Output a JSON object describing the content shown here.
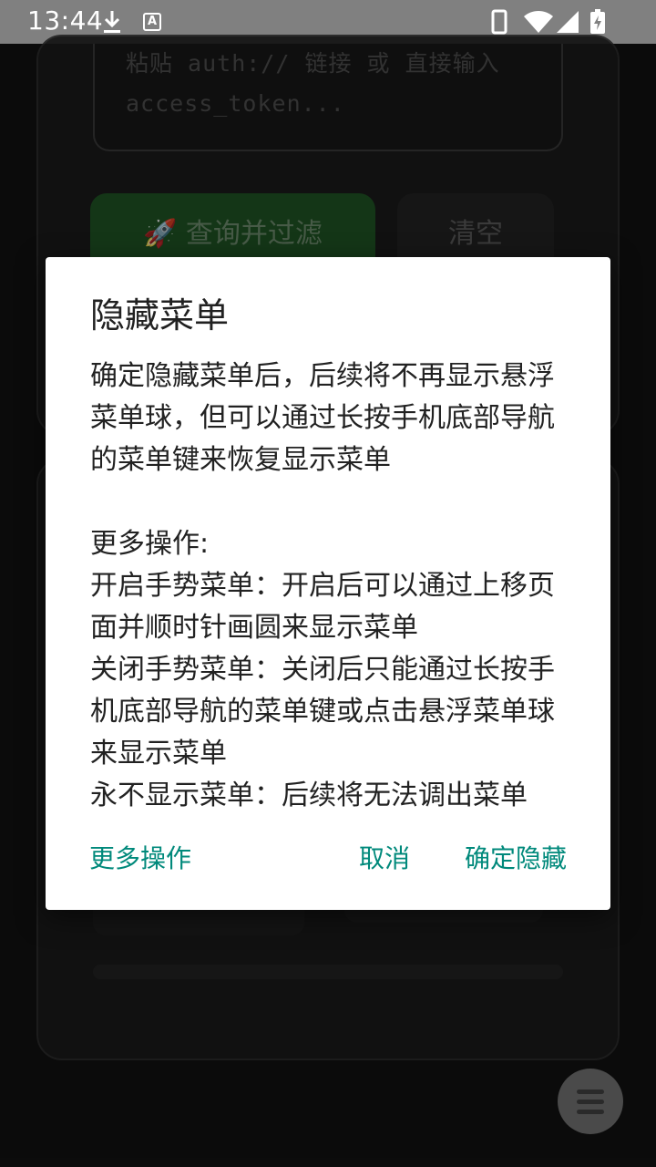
{
  "status_bar": {
    "time": "13:44",
    "icons": [
      "download-icon",
      "a-notification-icon",
      "phone-icon",
      "wifi-icon",
      "signal-icon",
      "battery-charging-icon"
    ],
    "a_icon_letter": "A"
  },
  "background": {
    "token_placeholder": "粘贴 auth:// 链接 或 直接输入 access_token...",
    "query_button": "🚀 查询并过滤",
    "clear_button": "清空"
  },
  "dialog": {
    "title": "隐藏菜单",
    "message": "确定隐藏菜单后，后续将不再显示悬浮菜单球，但可以通过长按手机底部导航的菜单键来恢复显示菜单\n\n更多操作:\n开启手势菜单：开启后可以通过上移页面并顺时针画圆来显示菜单\n关闭手势菜单：关闭后只能通过长按手机底部导航的菜单键或点击悬浮菜单球来显示菜单\n永不显示菜单：后续将无法调出菜单",
    "buttons": {
      "more": "更多操作",
      "cancel": "取消",
      "confirm": "确定隐藏"
    },
    "accent_color": "#00897b"
  }
}
